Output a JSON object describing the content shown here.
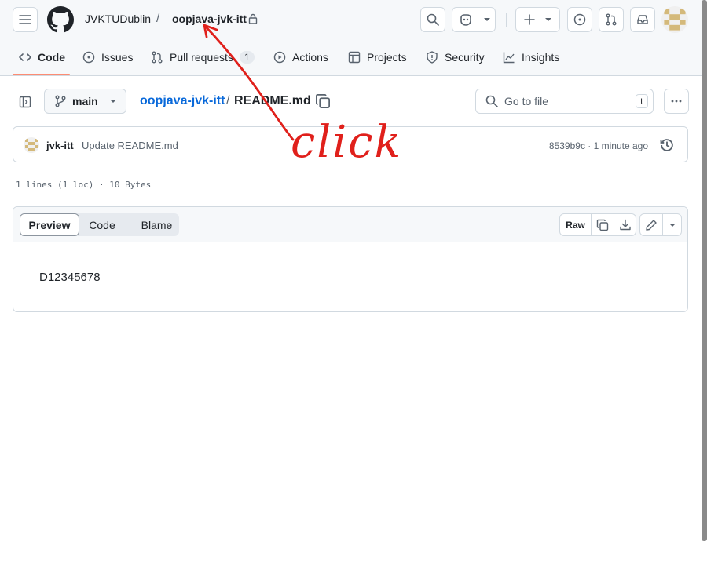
{
  "header": {
    "owner": "JVKTUDublin",
    "separator": "/",
    "repo": "oopjava-jvk-itt"
  },
  "tabs": [
    {
      "label": "Code",
      "icon": "code-icon",
      "active": true
    },
    {
      "label": "Issues",
      "icon": "issue-opened-icon"
    },
    {
      "label": "Pull requests",
      "icon": "git-pull-request-icon",
      "count": "1"
    },
    {
      "label": "Actions",
      "icon": "play-icon"
    },
    {
      "label": "Projects",
      "icon": "table-icon"
    },
    {
      "label": "Security",
      "icon": "shield-icon"
    },
    {
      "label": "Insights",
      "icon": "graph-icon"
    }
  ],
  "file_nav": {
    "branch": "main",
    "breadcrumb_repo": "oopjava-jvk-itt",
    "breadcrumb_sep": "/",
    "file_name": "README.md",
    "goto_placeholder": "Go to file",
    "goto_shortcut": "t"
  },
  "commit": {
    "author": "jvk-itt",
    "message": "Update README.md",
    "sha_time": "8539b9c · 1 minute ago"
  },
  "file_info": "1 lines (1 loc) · 10 Bytes",
  "file_view": {
    "modes": [
      "Preview",
      "Code",
      "Blame"
    ],
    "active_mode": "Preview",
    "raw_label": "Raw",
    "content": "D12345678"
  },
  "annotation": {
    "text": "click",
    "color": "#e0201b"
  },
  "colors": {
    "link": "#0969da",
    "tab_underline": "#fd8c73",
    "border": "#d1d9e0",
    "header_bg": "#f6f8fa"
  }
}
